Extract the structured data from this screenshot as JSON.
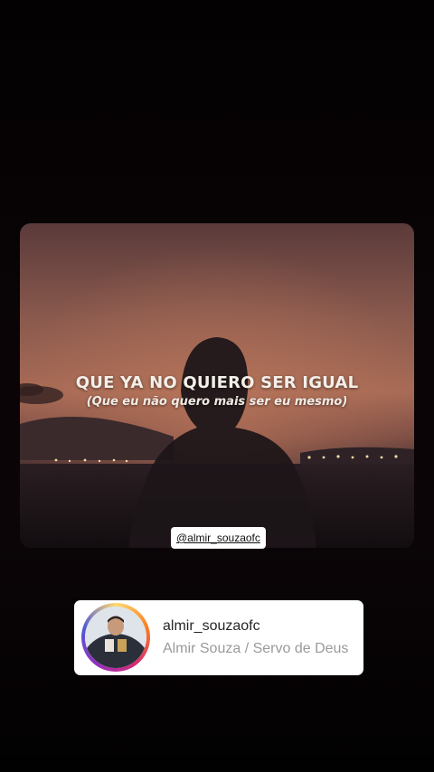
{
  "story": {
    "lyric_line": "QUE YA NO QUIERO SER IGUAL",
    "lyric_translation": "(Que eu não quero mais ser eu mesmo)",
    "mention_tag": "@almir_souzaofc"
  },
  "profile_card": {
    "username": "almir_souzaofc",
    "full_name": "Almir Souza / Servo de Deus"
  },
  "colors": {
    "background": "#000000",
    "sky_sunset": "#a76a55",
    "card_background": "#ffffff",
    "username_text": "#262626",
    "full_name_text": "#9a9a9a"
  }
}
